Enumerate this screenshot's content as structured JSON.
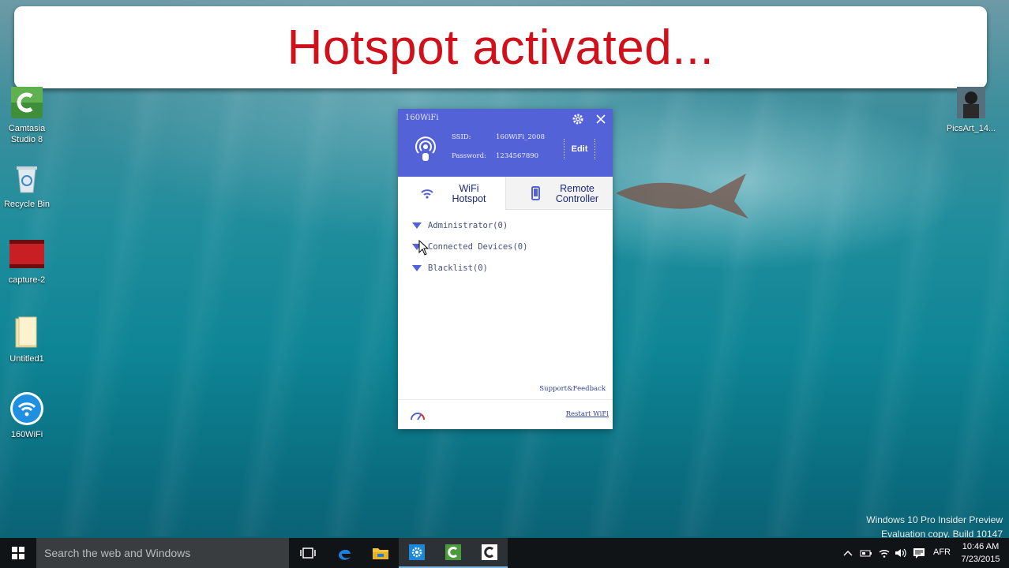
{
  "banner": {
    "text": "Hotspot activated..."
  },
  "desktop": {
    "icons": [
      {
        "label": "Camtasia\nStudio 8",
        "icon": "camtasia-icon"
      },
      {
        "label": "Recycle Bin",
        "icon": "recycle-bin-icon"
      },
      {
        "label": "capture-2",
        "icon": "video-file-icon"
      },
      {
        "label": "Untitled1",
        "icon": "folder-icon"
      },
      {
        "label": "160WiFi",
        "icon": "wifi-app-icon"
      },
      {
        "label": "PicsArt_14...",
        "icon": "photo-thumbnail-icon"
      }
    ]
  },
  "app": {
    "title": "160WiFi",
    "ssid_label": "SSID:",
    "ssid_value": "160WiFi_2008",
    "password_label": "Password:",
    "password_value": "1234567890",
    "edit_label": "Edit",
    "tabs": [
      {
        "label": "WiFi\nHotspot",
        "icon": "wifi-icon"
      },
      {
        "label": "Remote\nController",
        "icon": "phone-icon"
      }
    ],
    "groups": [
      {
        "label": "Administrator(0)"
      },
      {
        "label": "Connected Devices(0)"
      },
      {
        "label": "Blacklist(0)"
      }
    ],
    "support_label": "Support&Feedback",
    "restart_label": "Restart WiFi",
    "accent": "#5462d8"
  },
  "watermark": {
    "line1": "Windows 10 Pro Insider Preview",
    "line2": "Evaluation copy. Build 10147"
  },
  "taskbar": {
    "search_placeholder": "Search the web and Windows",
    "language": "AFR",
    "time": "10:46 AM",
    "date": "7/23/2015",
    "pinned": [
      "task-view-icon",
      "edge-icon",
      "file-explorer-icon",
      "settings-app-icon",
      "camtasia-icon",
      "camtasia-recorder-icon"
    ]
  }
}
